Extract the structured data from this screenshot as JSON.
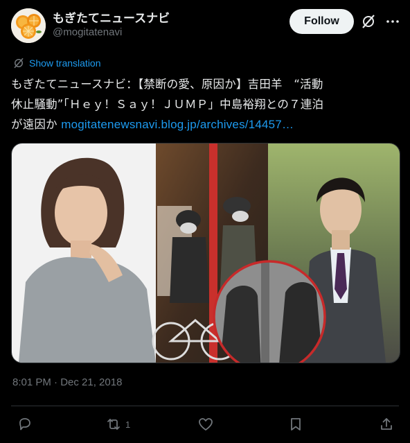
{
  "account": {
    "display_name": "もぎたてニュースナビ",
    "handle": "@mogitatenavi"
  },
  "header": {
    "follow_label": "Follow"
  },
  "tweet": {
    "show_translation": "Show translation",
    "text_line1": "もぎたてニュースナビ：【禁断の愛、原因か】吉田羊　“活動",
    "text_line2": "休止騒動”「Ｈｅｙ！Ｓａｙ！ＪＵＭＰ」中島裕翔との７連泊",
    "text_line3": "が遠因か ",
    "link": "mogitatenewsnavi.blog.jp/archives/14457…",
    "timestamp": "8:01 PM · Dec 21, 2018"
  },
  "actions": {
    "retweet_count": "1"
  },
  "icons": {
    "avatar": "orange-slices-avatar",
    "grok": "grok-icon",
    "more": "more-dots-icon",
    "translate": "translate-icon",
    "reply": "reply-icon",
    "retweet": "retweet-icon",
    "like": "heart-icon",
    "bookmark": "bookmark-icon",
    "share": "share-icon"
  },
  "colors": {
    "background": "#000000",
    "text": "#e7e9ea",
    "muted": "#71767b",
    "link": "#1d9bf0",
    "follow_bg": "#eff3f4",
    "border": "#2f3336"
  }
}
